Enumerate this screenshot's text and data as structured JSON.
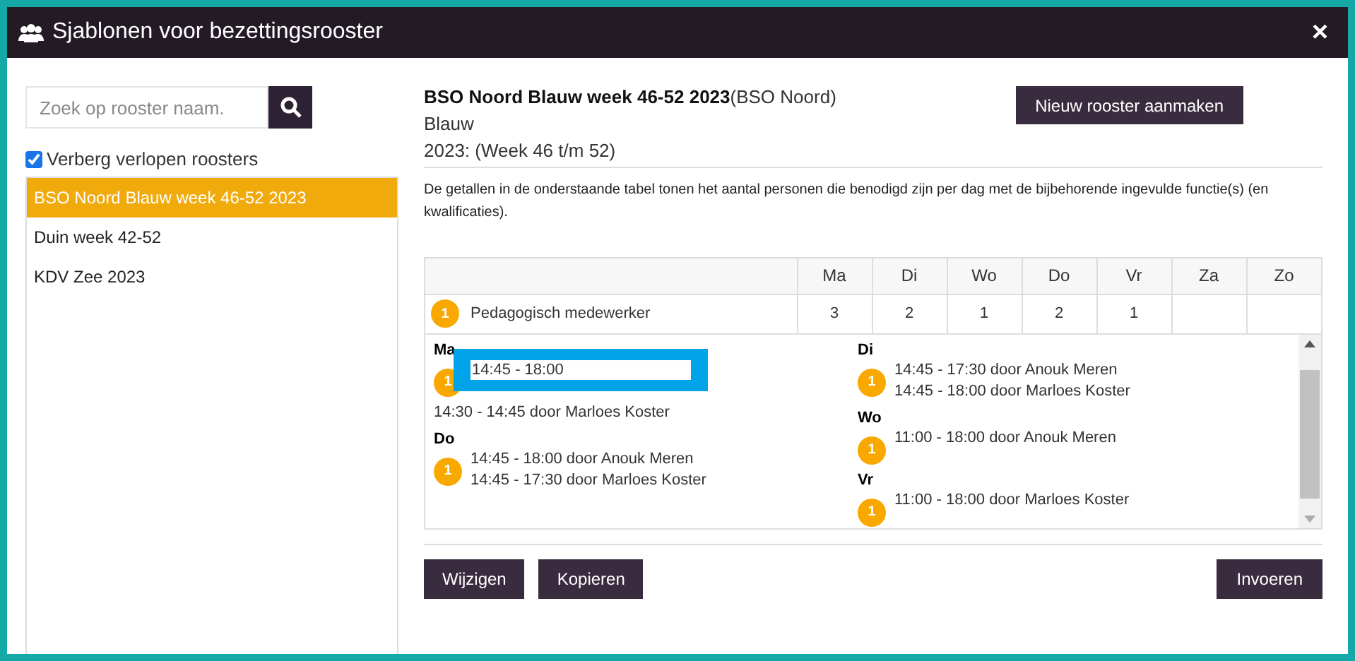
{
  "window": {
    "title": "Sjablonen voor bezettingsrooster",
    "close": "×"
  },
  "search": {
    "placeholder": "Zoek op rooster naam."
  },
  "hide_expired": {
    "label": "Verberg verlopen roosters",
    "checked": true
  },
  "roosters": [
    {
      "label": "BSO Noord Blauw week 46-52 2023",
      "selected": true
    },
    {
      "label": "Duin week 42-52",
      "selected": false
    },
    {
      "label": "KDV Zee 2023",
      "selected": false
    }
  ],
  "detail": {
    "name": "BSO Noord Blauw week 46-52 2023",
    "location": "(BSO Noord)",
    "group": "Blauw",
    "period": "2023: (Week 46 t/m 52)",
    "new_button": "Nieuw rooster aanmaken",
    "description": "De getallen in de onderstaande tabel tonen het aantal personen die benodigd zijn per dag met de bijbehorende ingevulde functie(s) (en kwalificaties)."
  },
  "table": {
    "columns": [
      "Ma",
      "Di",
      "Wo",
      "Do",
      "Vr",
      "Za",
      "Zo"
    ],
    "rows": [
      {
        "badge": "1",
        "function": "Pedagogisch medewerker",
        "cells": [
          "3",
          "2",
          "1",
          "2",
          "1",
          "",
          ""
        ]
      }
    ]
  },
  "day_columns": [
    [
      {
        "day": "Ma",
        "groups": [
          {
            "badge": "1",
            "lines": [
              {
                "kind": "edit",
                "text": "14:45 - 18:00"
              }
            ]
          },
          {
            "lines": [
              {
                "kind": "text",
                "text": "14:30 - 14:45 door Marloes Koster"
              }
            ]
          }
        ]
      },
      {
        "day": "Do",
        "groups": [
          {
            "badge": "1",
            "lines": [
              {
                "kind": "text",
                "text": "14:45 - 18:00 door Anouk Meren"
              },
              {
                "kind": "text",
                "text": "14:45 - 17:30 door Marloes Koster"
              }
            ]
          }
        ]
      }
    ],
    [
      {
        "day": "Di",
        "groups": [
          {
            "badge": "1",
            "lines": [
              {
                "kind": "text",
                "text": "14:45 - 17:30 door Anouk Meren"
              },
              {
                "kind": "text",
                "text": "14:45 - 18:00 door Marloes Koster"
              }
            ]
          }
        ]
      },
      {
        "day": "Wo",
        "groups": [
          {
            "badge": "1",
            "lines": [
              {
                "kind": "text",
                "text": "11:00 - 18:00 door Anouk Meren"
              }
            ]
          }
        ]
      },
      {
        "day": "Vr",
        "groups": [
          {
            "badge": "1",
            "lines": [
              {
                "kind": "text",
                "text": "11:00 - 18:00 door Marloes Koster"
              }
            ]
          }
        ]
      }
    ]
  ],
  "buttons": {
    "left": [
      "Wijzigen",
      "Kopieren"
    ],
    "right": [
      "Invoeren"
    ]
  }
}
